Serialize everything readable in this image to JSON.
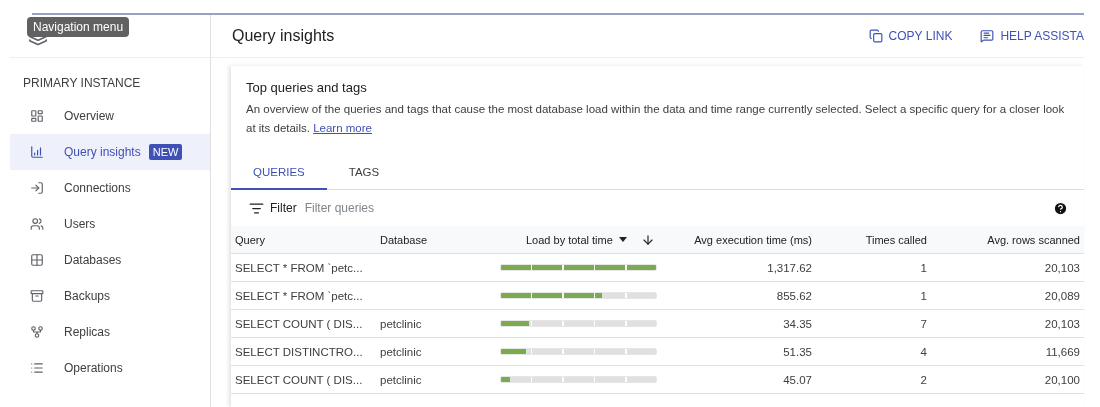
{
  "tooltip": "Navigation menu",
  "sidebar": {
    "heading": "PRIMARY INSTANCE",
    "items": [
      {
        "label": "Overview",
        "selected": false
      },
      {
        "label": "Query insights",
        "selected": true,
        "badge": "NEW"
      },
      {
        "label": "Connections",
        "selected": false
      },
      {
        "label": "Users",
        "selected": false
      },
      {
        "label": "Databases",
        "selected": false
      },
      {
        "label": "Backups",
        "selected": false
      },
      {
        "label": "Replicas",
        "selected": false
      },
      {
        "label": "Operations",
        "selected": false
      }
    ]
  },
  "header": {
    "title": "Query insights",
    "actions": [
      {
        "label": "COPY LINK"
      },
      {
        "label": "HELP ASSISTA"
      }
    ]
  },
  "card": {
    "title": "Top queries and tags",
    "description": "An overview of the queries and tags that cause the most database load within the data and time range currently selected. Select a specific query for a closer look at its details.",
    "link": "Learn more"
  },
  "tabs": [
    {
      "label": "QUERIES",
      "selected": true
    },
    {
      "label": "TAGS",
      "selected": false
    }
  ],
  "filter": {
    "label": "Filter",
    "placeholder": "Filter queries"
  },
  "table": {
    "columns": [
      "Query",
      "Database",
      "Load by total time",
      "Avg execution time (ms)",
      "Times called",
      "Avg. rows scanned"
    ],
    "rows": [
      {
        "query": "SELECT * FROM `petc...",
        "level": 1.0,
        "avg_time": "1,317.62",
        "times": "1",
        "rows": "20,103"
      },
      {
        "query": "SELECT * FROM `petc...",
        "level": 0.65,
        "avg_time": "855.62",
        "times": "1",
        "rows": "20,089"
      },
      {
        "query": "SELECT COUNT ( DIS...",
        "database": "petclinic",
        "level": 0.18,
        "avg_time": "34.35",
        "times": "7",
        "rows": "20,103"
      },
      {
        "query": "SELECT DISTINCTRO...",
        "database": "petclinic",
        "level": 0.16,
        "avg_time": "51.35",
        "times": "4",
        "rows": "11,669"
      },
      {
        "query": "SELECT COUNT ( DIS...",
        "database": "petclinic",
        "level": 0.06,
        "avg_time": "45.07",
        "times": "2",
        "rows": "20,100"
      }
    ]
  }
}
